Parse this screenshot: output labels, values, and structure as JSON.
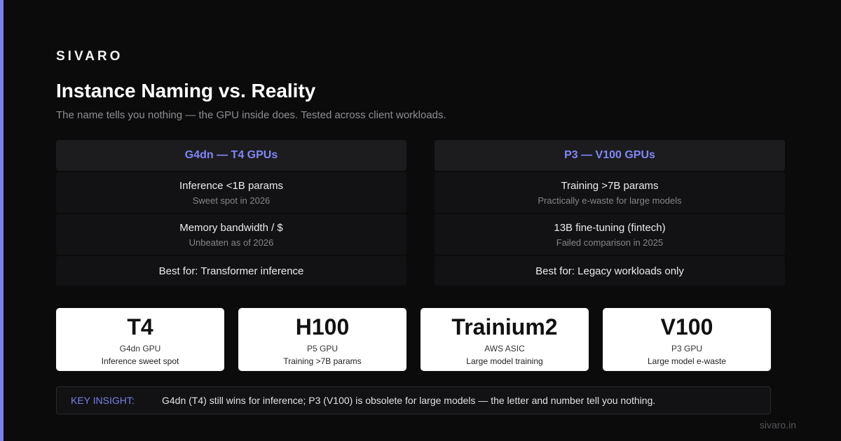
{
  "brand": "SIVARO",
  "header": {
    "title": "Instance Naming vs. Reality",
    "subtitle": "The name tells you nothing — the GPU inside does. Tested across client workloads."
  },
  "comparison": {
    "left": {
      "header": "G4dn — T4 GPUs",
      "rows": [
        {
          "main": "Inference <1B params",
          "sub": "Sweet spot in 2026"
        },
        {
          "main": "Memory bandwidth / $",
          "sub": "Unbeaten as of 2026"
        }
      ],
      "best": "Best for: Transformer inference"
    },
    "right": {
      "header": "P3 — V100 GPUs",
      "rows": [
        {
          "main": "Training >7B params",
          "sub": "Practically e-waste for large models"
        },
        {
          "main": "13B fine-tuning (fintech)",
          "sub": "Failed comparison in 2025"
        }
      ],
      "best": "Best for: Legacy workloads only"
    }
  },
  "cards": [
    {
      "big": "T4",
      "label": "G4dn GPU",
      "note": "Inference sweet spot"
    },
    {
      "big": "H100",
      "label": "P5 GPU",
      "note": "Training >7B params"
    },
    {
      "big": "Trainium2",
      "label": "AWS ASIC",
      "note": "Large model training"
    },
    {
      "big": "V100",
      "label": "P3 GPU",
      "note": "Large model e-waste"
    }
  ],
  "insight": {
    "tag": "KEY INSIGHT:",
    "text": "G4dn (T4) still wins for inference; P3 (V100) is obsolete for large models — the letter and number tell you nothing."
  },
  "footer": "sivaro.in",
  "colors": {
    "accent": "#7b7ff0",
    "background": "#0b0b0c",
    "card": "#ffffff"
  }
}
